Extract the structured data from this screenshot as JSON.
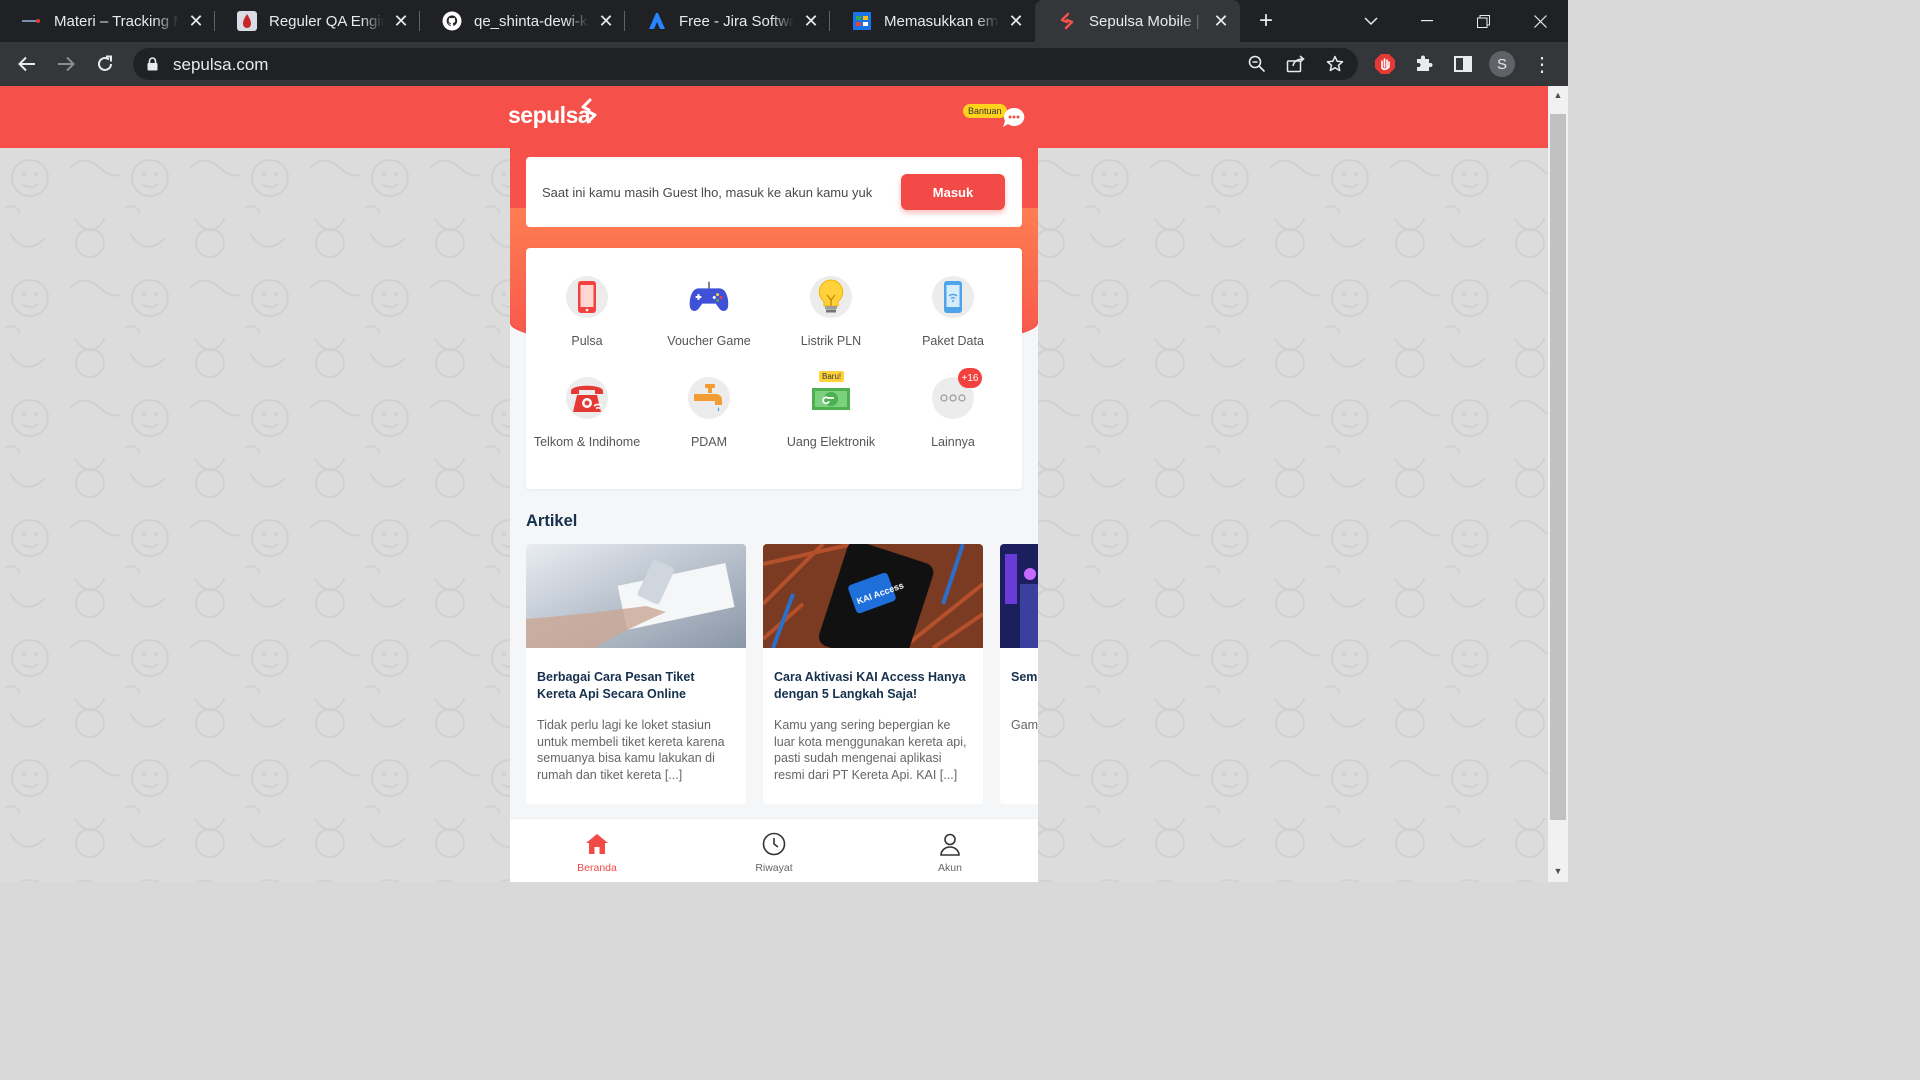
{
  "browser": {
    "tabs": [
      {
        "title": "Materi – Tracking M",
        "icon": "notion-icon"
      },
      {
        "title": "Reguler QA Enginee",
        "icon": "blood-drop-icon"
      },
      {
        "title": "qe_shinta-dewi-kur",
        "icon": "github-icon"
      },
      {
        "title": "Free - Jira Software",
        "icon": "jira-icon"
      },
      {
        "title": "Memasukkan email",
        "icon": "sheets-icon"
      },
      {
        "title": "Sepulsa Mobile | Isi",
        "icon": "sepulsa-icon",
        "active": true
      }
    ],
    "url": "sepulsa.com",
    "profile_initial": "S"
  },
  "site": {
    "logo": "sepulsa",
    "help_label": "Bantuan",
    "brand_color": "#f5504a"
  },
  "guest": {
    "message": "Saat ini kamu masih Guest lho, masuk ke akun kamu yuk",
    "login_label": "Masuk"
  },
  "services": [
    {
      "label": "Pulsa",
      "icon": "phone-icon"
    },
    {
      "label": "Voucher Game",
      "icon": "gamepad-icon"
    },
    {
      "label": "Listrik PLN",
      "icon": "lightbulb-icon"
    },
    {
      "label": "Paket Data",
      "icon": "data-phone-icon"
    },
    {
      "label": "Telkom & Indihome",
      "icon": "telephone-icon"
    },
    {
      "label": "PDAM",
      "icon": "water-tap-icon"
    },
    {
      "label": "Uang Elektronik",
      "icon": "e-money-icon",
      "badge": "Baru!"
    },
    {
      "label": "Lainnya",
      "icon": "more-icon",
      "badge": "+16"
    }
  ],
  "articles": {
    "heading": "Artikel",
    "items": [
      {
        "title": "Berbagai Cara Pesan Tiket Kereta Api Secara Online",
        "excerpt": "Tidak perlu lagi ke loket stasiun untuk membeli tiket kereta karena semuanya bisa kamu lakukan di rumah dan tiket kereta [...]"
      },
      {
        "title": "Cara Aktivasi KAI Access Hanya dengan 5 Langkah Saja!",
        "excerpt": "Kamu yang sering bepergian ke luar kota menggunakan kereta api, pasti sudah mengenai aplikasi resmi dari PT Kereta Api. KAI [...]",
        "thumb_text": "KAI Access"
      },
      {
        "title": "Semu Uang",
        "excerpt": "Game perm masy perm"
      }
    ]
  },
  "bottom_nav": [
    {
      "label": "Beranda",
      "icon": "home-icon",
      "active": true
    },
    {
      "label": "Riwayat",
      "icon": "clock-icon"
    },
    {
      "label": "Akun",
      "icon": "user-icon"
    }
  ]
}
